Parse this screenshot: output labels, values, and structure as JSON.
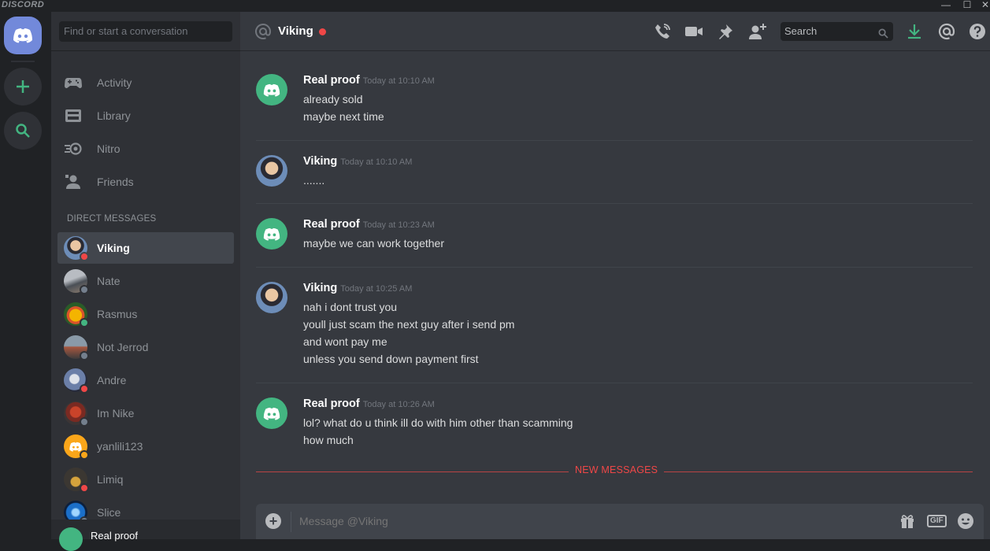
{
  "app": {
    "wordmark": "DISCORD",
    "colors": {
      "blurple": "#7289da",
      "green": "#43b581",
      "red": "#f04747",
      "grey": "#747f8d",
      "yellow": "#faa61a"
    }
  },
  "window_controls": {
    "minimize": "—",
    "maximize": "☐",
    "close": "✕"
  },
  "guilds": {
    "items": [
      {
        "name": "home",
        "icon": "discord-logo-icon"
      },
      {
        "name": "add-server",
        "icon": "plus-icon"
      },
      {
        "name": "explore",
        "icon": "search-icon"
      }
    ]
  },
  "sidebar": {
    "search_placeholder": "Find or start a conversation",
    "nav": [
      {
        "label": "Activity",
        "icon": "gamepad-icon"
      },
      {
        "label": "Library",
        "icon": "library-icon"
      },
      {
        "label": "Nitro",
        "icon": "nitro-icon"
      },
      {
        "label": "Friends",
        "icon": "friends-icon"
      }
    ],
    "dm_header": "DIRECT MESSAGES",
    "dms": [
      {
        "name": "Viking",
        "status": "dnd",
        "active": true
      },
      {
        "name": "Nate",
        "status": "offline"
      },
      {
        "name": "Rasmus",
        "status": "online"
      },
      {
        "name": "Not Jerrod",
        "status": "offline"
      },
      {
        "name": "Andre",
        "status": "dnd"
      },
      {
        "name": "Im Nike",
        "status": "offline"
      },
      {
        "name": "yanlili123",
        "status": "idle"
      },
      {
        "name": "Limiq",
        "status": "dnd"
      },
      {
        "name": "Slice",
        "status": "offline"
      }
    ],
    "user": {
      "name": "Real proof"
    }
  },
  "chat": {
    "header": {
      "at_icon": "at-icon",
      "name": "Viking",
      "search_placeholder": "Search"
    },
    "messages": [
      {
        "author": "Real proof",
        "timestamp": "Today at 10:10 AM",
        "avatar": "discord-default",
        "lines": [
          "already sold",
          "maybe next time"
        ]
      },
      {
        "author": "Viking",
        "timestamp": "Today at 10:10 AM",
        "avatar": "viking",
        "lines": [
          "......."
        ]
      },
      {
        "author": "Real proof",
        "timestamp": "Today at 10:23 AM",
        "avatar": "discord-default",
        "lines": [
          "maybe we can work together"
        ]
      },
      {
        "author": "Viking",
        "timestamp": "Today at 10:25 AM",
        "avatar": "viking",
        "lines": [
          "nah i dont trust you",
          "youll just scam the next guy after i send pm",
          "and wont pay me",
          "unless you send down payment first"
        ]
      },
      {
        "author": "Real proof",
        "timestamp": "Today at 10:26 AM",
        "avatar": "discord-default",
        "lines": [
          "lol? what do u think ill do with him other than scamming",
          "how much"
        ]
      }
    ],
    "new_messages_label": "NEW MESSAGES",
    "composer": {
      "placeholder": "Message @Viking",
      "gif_label": "GIF"
    }
  }
}
